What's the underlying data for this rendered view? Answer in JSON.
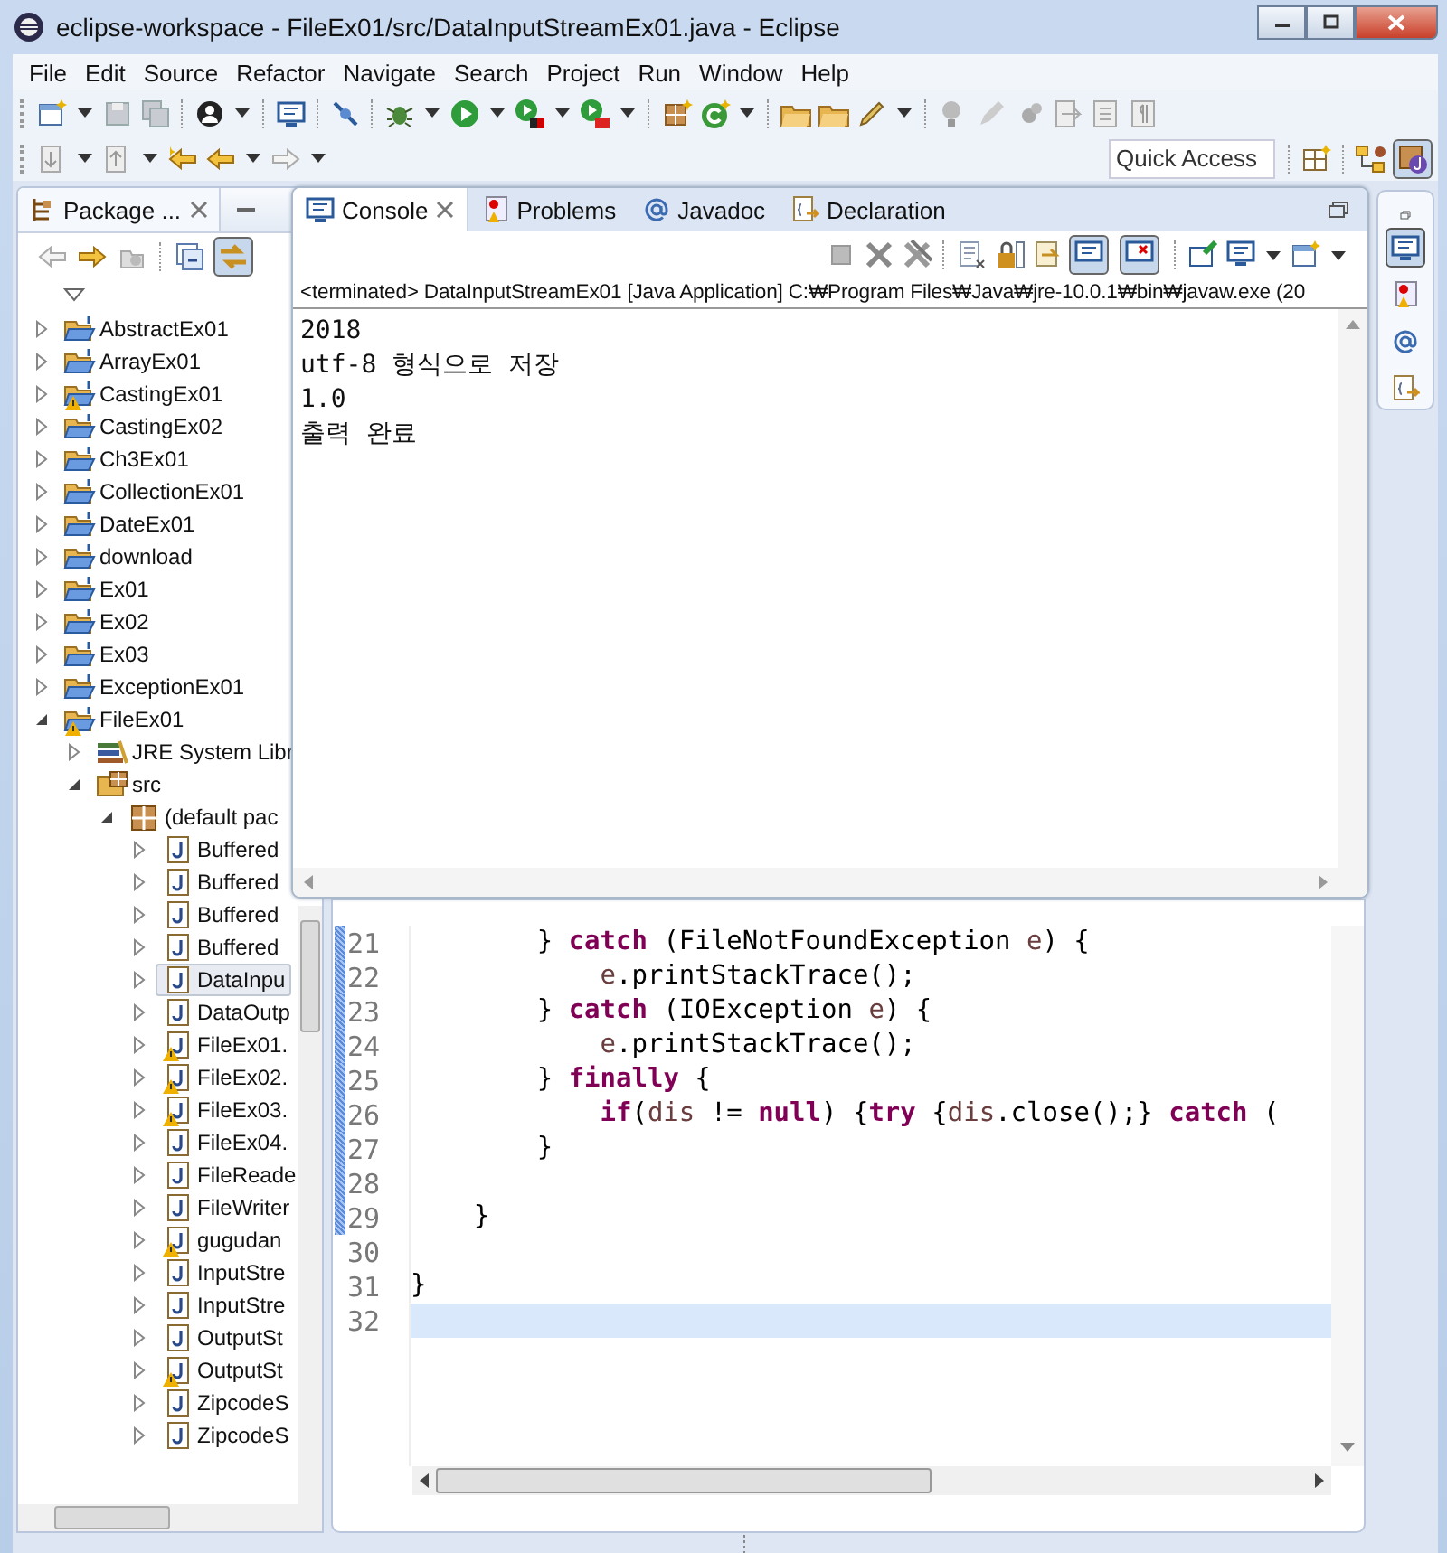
{
  "window": {
    "title": "eclipse-workspace - FileEx01/src/DataInputStreamEx01.java - Eclipse"
  },
  "menu": [
    "File",
    "Edit",
    "Source",
    "Refactor",
    "Navigate",
    "Search",
    "Project",
    "Run",
    "Window",
    "Help"
  ],
  "quick_access": {
    "placeholder": "Quick Access"
  },
  "package_explorer": {
    "title": "Package ...",
    "tree": [
      {
        "label": "AbstractEx01",
        "kind": "project",
        "expanded": false,
        "warning": false,
        "selected": false
      },
      {
        "label": "ArrayEx01",
        "kind": "project",
        "expanded": false,
        "warning": false,
        "selected": false
      },
      {
        "label": "CastingEx01",
        "kind": "project",
        "expanded": false,
        "warning": true,
        "selected": false
      },
      {
        "label": "CastingEx02",
        "kind": "project",
        "expanded": false,
        "warning": false,
        "selected": false
      },
      {
        "label": "Ch3Ex01",
        "kind": "project",
        "expanded": false,
        "warning": false,
        "selected": false
      },
      {
        "label": "CollectionEx01",
        "kind": "project",
        "expanded": false,
        "warning": false,
        "selected": false
      },
      {
        "label": "DateEx01",
        "kind": "project",
        "expanded": false,
        "warning": false,
        "selected": false
      },
      {
        "label": "download",
        "kind": "project",
        "expanded": false,
        "warning": false,
        "selected": false
      },
      {
        "label": "Ex01",
        "kind": "project",
        "expanded": false,
        "warning": false,
        "selected": false
      },
      {
        "label": "Ex02",
        "kind": "project",
        "expanded": false,
        "warning": false,
        "selected": false
      },
      {
        "label": "Ex03",
        "kind": "project",
        "expanded": false,
        "warning": false,
        "selected": false
      },
      {
        "label": "ExceptionEx01",
        "kind": "project",
        "expanded": false,
        "warning": false,
        "selected": false
      },
      {
        "label": "FileEx01",
        "kind": "project",
        "expanded": true,
        "warning": true,
        "selected": false,
        "children": [
          {
            "label": "JRE System Libr",
            "kind": "library",
            "expanded": false,
            "warning": false,
            "selected": false
          },
          {
            "label": "src",
            "kind": "source",
            "expanded": true,
            "warning": false,
            "selected": false,
            "children": [
              {
                "label": "(default pac",
                "kind": "package",
                "expanded": true,
                "warning": false,
                "selected": false,
                "children": [
                  {
                    "label": "Buffered",
                    "kind": "java",
                    "expanded": false,
                    "warning": false,
                    "selected": false
                  },
                  {
                    "label": "Buffered",
                    "kind": "java",
                    "expanded": false,
                    "warning": false,
                    "selected": false
                  },
                  {
                    "label": "Buffered",
                    "kind": "java",
                    "expanded": false,
                    "warning": false,
                    "selected": false
                  },
                  {
                    "label": "Buffered",
                    "kind": "java",
                    "expanded": false,
                    "warning": false,
                    "selected": false
                  },
                  {
                    "label": "DataInpu",
                    "kind": "java",
                    "expanded": false,
                    "warning": false,
                    "selected": true
                  },
                  {
                    "label": "DataOutp",
                    "kind": "java",
                    "expanded": false,
                    "warning": false,
                    "selected": false
                  },
                  {
                    "label": "FileEx01.",
                    "kind": "java",
                    "expanded": false,
                    "warning": true,
                    "selected": false
                  },
                  {
                    "label": "FileEx02.",
                    "kind": "java",
                    "expanded": false,
                    "warning": true,
                    "selected": false
                  },
                  {
                    "label": "FileEx03.",
                    "kind": "java",
                    "expanded": false,
                    "warning": true,
                    "selected": false
                  },
                  {
                    "label": "FileEx04.",
                    "kind": "java",
                    "expanded": false,
                    "warning": false,
                    "selected": false
                  },
                  {
                    "label": "FileReade",
                    "kind": "java",
                    "expanded": false,
                    "warning": false,
                    "selected": false
                  },
                  {
                    "label": "FileWriter",
                    "kind": "java",
                    "expanded": false,
                    "warning": false,
                    "selected": false
                  },
                  {
                    "label": "gugudan",
                    "kind": "java",
                    "expanded": false,
                    "warning": true,
                    "selected": false
                  },
                  {
                    "label": "InputStre",
                    "kind": "java",
                    "expanded": false,
                    "warning": false,
                    "selected": false
                  },
                  {
                    "label": "InputStre",
                    "kind": "java",
                    "expanded": false,
                    "warning": false,
                    "selected": false
                  },
                  {
                    "label": "OutputSt",
                    "kind": "java",
                    "expanded": false,
                    "warning": false,
                    "selected": false
                  },
                  {
                    "label": "OutputSt",
                    "kind": "java",
                    "expanded": false,
                    "warning": true,
                    "selected": false
                  },
                  {
                    "label": "ZipcodeS",
                    "kind": "java",
                    "expanded": false,
                    "warning": false,
                    "selected": false
                  },
                  {
                    "label": "ZipcodeS",
                    "kind": "java",
                    "expanded": false,
                    "warning": false,
                    "selected": false
                  }
                ]
              }
            ]
          }
        ]
      }
    ]
  },
  "console": {
    "tabs": [
      {
        "label": "Console",
        "kind": "console",
        "selected": true
      },
      {
        "label": "Problems",
        "kind": "problems",
        "selected": false
      },
      {
        "label": "Javadoc",
        "kind": "javadoc",
        "selected": false
      },
      {
        "label": "Declaration",
        "kind": "declaration",
        "selected": false
      }
    ],
    "header": "<terminated> DataInputStreamEx01 [Java Application] C:₩Program Files₩Java₩jre-10.0.1₩bin₩javaw.exe (20",
    "output": [
      "2018",
      "utf-8 형식으로 저장",
      "1.0",
      "출력 완료"
    ]
  },
  "editor": {
    "lines": [
      {
        "number": "21",
        "changed": true,
        "current": false,
        "tokens": [
          {
            "kind": "plain",
            "text": "        } "
          },
          {
            "kind": "keyword",
            "text": "catch"
          },
          {
            "kind": "plain",
            "text": " (FileNotFoundException "
          },
          {
            "kind": "variable",
            "text": "e"
          },
          {
            "kind": "plain",
            "text": ") {"
          }
        ]
      },
      {
        "number": "22",
        "changed": true,
        "current": false,
        "tokens": [
          {
            "kind": "variable",
            "text": "            e"
          },
          {
            "kind": "plain",
            "text": ".printStackTrace();"
          }
        ]
      },
      {
        "number": "23",
        "changed": true,
        "current": false,
        "tokens": [
          {
            "kind": "plain",
            "text": "        } "
          },
          {
            "kind": "keyword",
            "text": "catch"
          },
          {
            "kind": "plain",
            "text": " (IOException "
          },
          {
            "kind": "variable",
            "text": "e"
          },
          {
            "kind": "plain",
            "text": ") {"
          }
        ]
      },
      {
        "number": "24",
        "changed": true,
        "current": false,
        "tokens": [
          {
            "kind": "variable",
            "text": "            e"
          },
          {
            "kind": "plain",
            "text": ".printStackTrace();"
          }
        ]
      },
      {
        "number": "25",
        "changed": true,
        "current": false,
        "tokens": [
          {
            "kind": "plain",
            "text": "        } "
          },
          {
            "kind": "keyword",
            "text": "finally"
          },
          {
            "kind": "plain",
            "text": " {"
          }
        ]
      },
      {
        "number": "26",
        "changed": true,
        "current": false,
        "tokens": [
          {
            "kind": "keyword",
            "text": "            if"
          },
          {
            "kind": "plain",
            "text": "("
          },
          {
            "kind": "variable",
            "text": "dis"
          },
          {
            "kind": "plain",
            "text": " != "
          },
          {
            "kind": "keyword",
            "text": "null"
          },
          {
            "kind": "plain",
            "text": ") {"
          },
          {
            "kind": "keyword",
            "text": "try"
          },
          {
            "kind": "plain",
            "text": " {"
          },
          {
            "kind": "variable",
            "text": "dis"
          },
          {
            "kind": "plain",
            "text": ".close();} "
          },
          {
            "kind": "keyword",
            "text": "catch"
          },
          {
            "kind": "plain",
            "text": " ("
          }
        ]
      },
      {
        "number": "27",
        "changed": true,
        "current": false,
        "tokens": [
          {
            "kind": "plain",
            "text": "        }"
          }
        ]
      },
      {
        "number": "28",
        "changed": true,
        "current": false
      },
      {
        "number": "29",
        "changed": true,
        "current": false,
        "tokens": [
          {
            "kind": "plain",
            "text": "    }"
          }
        ]
      },
      {
        "number": "30",
        "changed": false,
        "current": false
      },
      {
        "number": "31",
        "changed": false,
        "current": false,
        "tokens": [
          {
            "kind": "plain",
            "text": "}"
          }
        ]
      },
      {
        "number": "32",
        "changed": false,
        "current": true
      }
    ]
  },
  "trim_stack": [
    {
      "kind": "console",
      "selected": true
    },
    {
      "kind": "problems",
      "selected": false
    },
    {
      "kind": "javadoc",
      "selected": false
    },
    {
      "kind": "declaration",
      "selected": false
    }
  ]
}
